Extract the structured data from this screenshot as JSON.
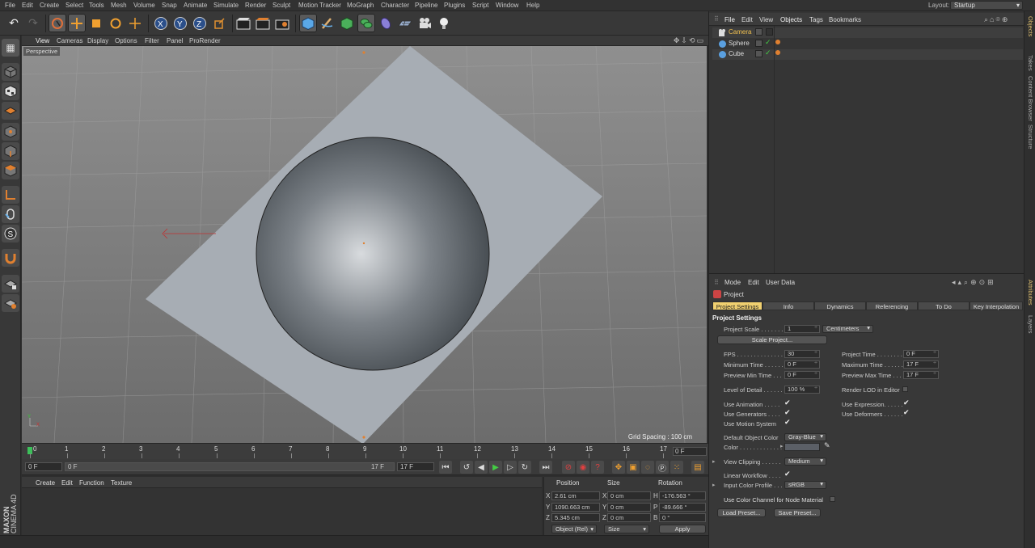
{
  "menubar": {
    "items": [
      "File",
      "Edit",
      "Create",
      "Select",
      "Tools",
      "Mesh",
      "Volume",
      "Snap",
      "Animate",
      "Simulate",
      "Render",
      "Sculpt",
      "Motion Tracker",
      "MoGraph",
      "Character",
      "Pipeline",
      "Plugins",
      "Script",
      "Window",
      "Help"
    ],
    "layout_label": "Layout:",
    "layout_value": "Startup"
  },
  "viewport": {
    "menu": [
      "View",
      "Cameras",
      "Display",
      "Options",
      "Filter",
      "Panel",
      "ProRender"
    ],
    "label": "Perspective",
    "grid_spacing": "Grid Spacing : 100 cm"
  },
  "timeline": {
    "ticks": [
      "0",
      "1",
      "2",
      "3",
      "4",
      "5",
      "6",
      "7",
      "8",
      "9",
      "10",
      "11",
      "12",
      "13",
      "14",
      "15",
      "16",
      "17"
    ],
    "frame": "0 F"
  },
  "transport": {
    "start": "0 F",
    "range_start": "0 F",
    "range_end": "17 F",
    "end": "17 F"
  },
  "material": {
    "menu": [
      "Create",
      "Edit",
      "Function",
      "Texture"
    ],
    "brand_line1": "MAXON",
    "brand_line2": "CINEMA 4D"
  },
  "coords": {
    "headers": [
      "Position",
      "Size",
      "Rotation"
    ],
    "rows": [
      {
        "axis": "X",
        "pos": "2.61 cm",
        "size_axis": "X",
        "size": "0 cm",
        "rot_axis": "H",
        "rot": "-176.563 °"
      },
      {
        "axis": "Y",
        "pos": "1090.663 cm",
        "size_axis": "Y",
        "size": "0 cm",
        "rot_axis": "P",
        "rot": "-89.666 °"
      },
      {
        "axis": "Z",
        "pos": "5.345 cm",
        "size_axis": "Z",
        "size": "0 cm",
        "rot_axis": "B",
        "rot": "0 °"
      }
    ],
    "mode_select": "Object (Rel)",
    "size_select": "Size",
    "apply": "Apply"
  },
  "object_manager": {
    "menu": [
      "File",
      "Edit",
      "View",
      "Objects",
      "Tags",
      "Bookmarks"
    ],
    "objects": [
      {
        "name": "Camera",
        "color": "#6a8fd0"
      },
      {
        "name": "Sphere",
        "color": "#5aa0e0"
      },
      {
        "name": "Cube",
        "color": "#5aa0e0"
      }
    ]
  },
  "side_tabs": [
    "Objects",
    "Takes",
    "Content Browser",
    "Structure",
    "Attributes",
    "Layers"
  ],
  "attributes": {
    "menu": [
      "Mode",
      "Edit",
      "User Data"
    ],
    "title": "Project",
    "tabs": [
      "Project Settings",
      "Info",
      "Dynamics",
      "Referencing",
      "To Do",
      "Key Interpolation"
    ],
    "section": "Project Settings",
    "project_scale_label": "Project Scale . . . . . . . .",
    "project_scale_value": "1",
    "project_scale_unit": "Centimeters",
    "scale_project_btn": "Scale Project...",
    "fps_label": "FPS . . . . . . . . . . . . . . .",
    "fps_value": "30",
    "project_time_label": "Project Time . . . . . . . .",
    "project_time_value": "0 F",
    "min_time_label": "Minimum Time . . . . . . .",
    "min_time_value": "0 F",
    "max_time_label": "Maximum Time . . . . . . .",
    "max_time_value": "17 F",
    "prev_min_label": "Preview Min Time . . .",
    "prev_min_value": "0 F",
    "prev_max_label": "Preview Max Time . . .",
    "prev_max_value": "17 F",
    "lod_label": "Level of Detail . . . . . .",
    "lod_value": "100 %",
    "render_lod_label": "Render LOD in Editor",
    "use_anim_label": "Use Animation . . . . .",
    "use_expr_label": "Use Expression. . . . . .",
    "use_gen_label": "Use Generators . . . .",
    "use_def_label": "Use Deformers . . . . . .",
    "use_motion_label": "Use Motion System",
    "default_color_label": "Default Object Color",
    "default_color_value": "Gray-Blue",
    "color_label": "Color . . . . . . . . . . . . .",
    "view_clip_label": "View Clipping . . . . . .",
    "view_clip_value": "Medium",
    "linear_label": "Linear Workflow . . . .",
    "input_color_label": "Input Color Profile . . .",
    "input_color_value": "sRGB",
    "node_mat_label": "Use Color Channel for Node Material",
    "load_preset": "Load Preset...",
    "save_preset": "Save Preset..."
  }
}
